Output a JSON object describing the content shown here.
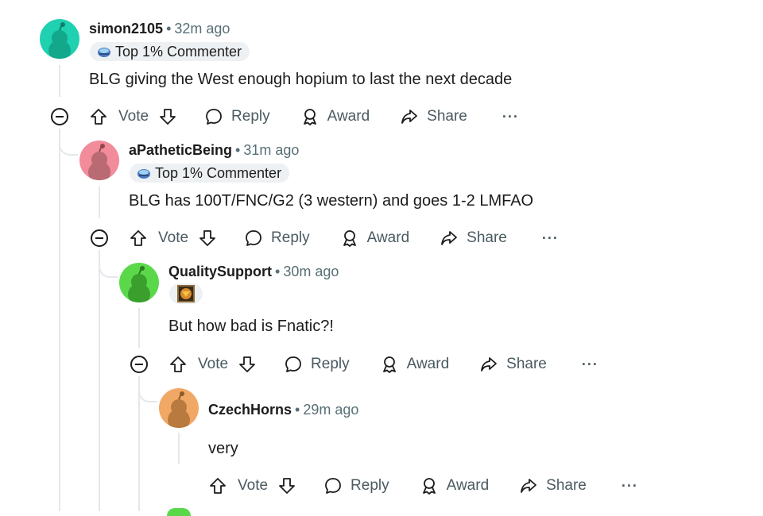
{
  "comments": [
    {
      "username": "simon2105",
      "time": "32m ago",
      "flair": "Top 1% Commenter",
      "body": "BLG giving the West enough hopium to last the next decade",
      "avatar_color": "#1fd1b0"
    },
    {
      "username": "aPatheticBeing",
      "time": "31m ago",
      "flair": "Top 1% Commenter",
      "body": "BLG has 100T/FNC/G2 (3 western) and goes 1-2 LMFAO",
      "avatar_color": "#f28b9a"
    },
    {
      "username": "QualitySupport",
      "time": "30m ago",
      "flair": "",
      "body": "But how bad is Fnatic?!",
      "avatar_color": "#5ad84a"
    },
    {
      "username": "CzechHorns",
      "time": "29m ago",
      "flair": "",
      "body": "very",
      "avatar_color": "#f2a865"
    }
  ],
  "actions": {
    "vote": "Vote",
    "reply": "Reply",
    "award": "Award",
    "share": "Share",
    "more": "···"
  },
  "separator": "•",
  "icons": [
    "snoo-avatar-icon",
    "upvote-icon",
    "downvote-icon",
    "comment-bubble-icon",
    "award-icon",
    "share-arrow-icon",
    "collapse-minus-icon",
    "more-dots-icon",
    "top-commenter-icon",
    "user-flair-image"
  ]
}
